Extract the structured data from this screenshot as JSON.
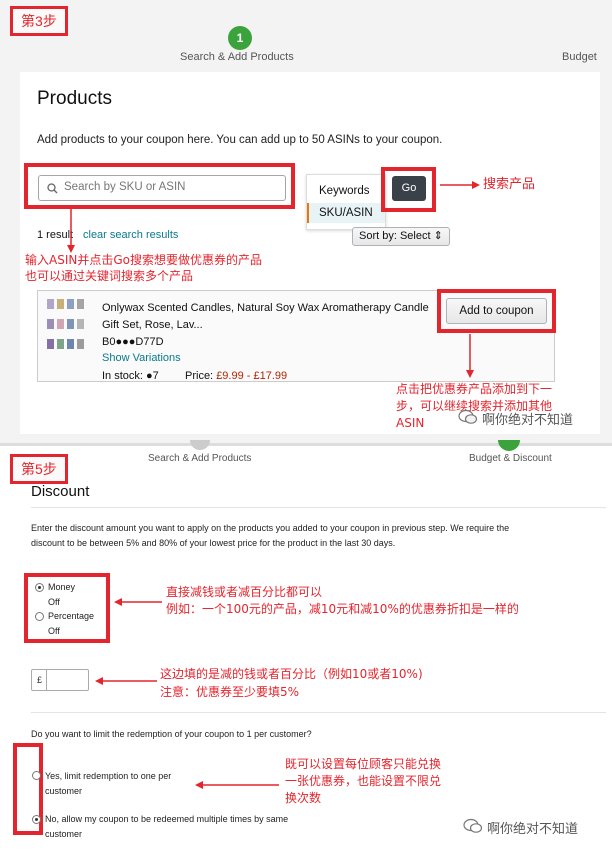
{
  "panel1": {
    "step_tag": "第3步",
    "stepper": {
      "step_number": "1",
      "step1_label": "Search & Add Products",
      "step2_label": "Budget"
    },
    "products": {
      "title": "Products",
      "description": "Add products to your coupon here. You can add up to 50 ASINs to your coupon.",
      "search_placeholder": "Search by SKU or ASIN",
      "search_type": {
        "options": [
          "Keywords",
          "SKU/ASIN"
        ],
        "selected": "SKU/ASIN"
      },
      "go_label": "Go",
      "results_count": "1 result",
      "clear_link": "clear search results",
      "sort_label": "Sort by:",
      "sort_value": "Select ⇕",
      "item": {
        "title_line1": "Onlywax Scented Candles, Natural Soy Wax Aromatherapy Candle",
        "title_line2": "Gift Set, Rose, Lav...",
        "asin": "B0●●●D77D",
        "show_variations": "Show Variations",
        "stock_label": "In stock: ",
        "stock_value": "●7",
        "price_label": "Price: ",
        "price_value": "£9.99 - £17.99",
        "add_label": "Add to coupon"
      }
    },
    "annotations": {
      "search_products": "搜索产品",
      "input_asin_line1": "输入ASIN并点击Go搜索想要做优惠券的产品",
      "input_asin_line2": "也可以通过关键词搜索多个产品",
      "add_line1": "点击把优惠券产品添加到下一",
      "add_line2": "步，可以继续搜索并添加其他",
      "add_line3": "ASIN"
    },
    "watermark": "啊你绝对不知道"
  },
  "panel2": {
    "step_tag": "第5步",
    "stepper": {
      "step1_label": "Search & Add Products",
      "step2_label": "Budget & Discount"
    },
    "discount": {
      "title": "Discount",
      "description_line1": "Enter the discount amount you want to apply on the products you added to your coupon in previous step. We require the",
      "description_line2": "discount to be between 5% and 80% of your lowest price for the product in the last 30 days.",
      "money_label": "Money",
      "money_state": "Off",
      "percentage_label": "Percentage",
      "percentage_state": "Off",
      "currency_symbol": "£",
      "amount_value": ""
    },
    "limit": {
      "question": "Do you want to limit the redemption of your coupon to 1 per customer?",
      "yes_line1": "Yes, limit redemption to one per",
      "yes_line2": "customer",
      "no_line1": "No, allow my coupon to be redeemed multiple times by same",
      "no_line2": "customer"
    },
    "annotations": {
      "discount_line1": "直接减钱或者减百分比都可以",
      "discount_line2": "例如：一个100元的产品，减10元和减10%的优惠券折扣是一样的",
      "amount_line1": "这边填的是减的钱或者百分比（例如10或者10%)",
      "amount_line2": "注意：优惠券至少要填5%",
      "limit_line1": "既可以设置每位顾客只能兑换",
      "limit_line2": "一张优惠券，也能设置不限兑",
      "limit_line3": "换次数"
    },
    "watermark": "啊你绝对不知道"
  },
  "colors": {
    "annotation_red": "#e3262e",
    "step_green": "#3aa33b",
    "link_teal": "#0a7a8c",
    "price_red": "#b12704",
    "go_dark": "#3a4149"
  }
}
